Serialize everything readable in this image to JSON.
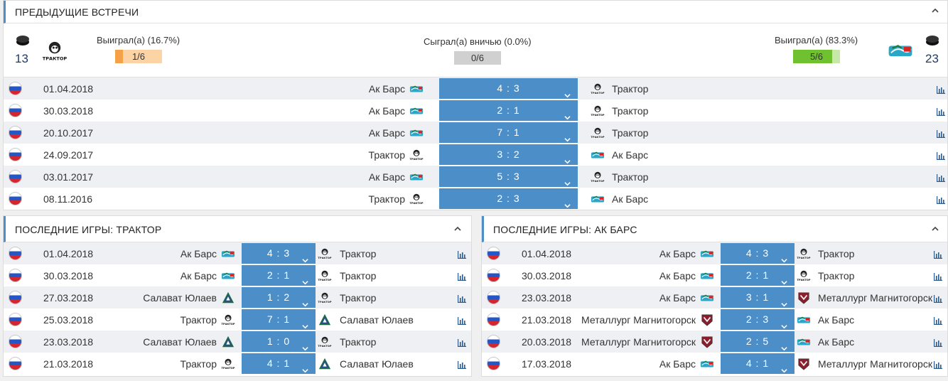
{
  "h2h": {
    "title": "ПРЕДЫДУЩИЕ ВСТРЕЧИ",
    "left_count": "13",
    "right_count": "23",
    "left_team_logo": "traktor-logo",
    "right_team_logo": "ak-bars-logo",
    "win_left": {
      "label": "Выиграл(а) (16.7%)",
      "value": "1/6",
      "fraction": 0.167,
      "color": "#f5a147"
    },
    "draw": {
      "label": "Сыграл(а) вничью (0.0%)",
      "value": "0/6",
      "fraction": 0.0,
      "color": "#c8c8c8"
    },
    "win_right": {
      "label": "Выиграл(а) (83.3%)",
      "value": "5/6",
      "fraction": 0.833,
      "color": "#6fc12f"
    },
    "matches": [
      {
        "date": "01.04.2018",
        "home": "Ак Барс",
        "home_logo": "ak-bars-logo",
        "score": "4 : 3",
        "away": "Трактор",
        "away_logo": "traktor-logo"
      },
      {
        "date": "30.03.2018",
        "home": "Ак Барс",
        "home_logo": "ak-bars-logo",
        "score": "2 : 1",
        "away": "Трактор",
        "away_logo": "traktor-logo"
      },
      {
        "date": "20.10.2017",
        "home": "Ак Барс",
        "home_logo": "ak-bars-logo",
        "score": "7 : 1",
        "away": "Трактор",
        "away_logo": "traktor-logo"
      },
      {
        "date": "24.09.2017",
        "home": "Трактор",
        "home_logo": "traktor-logo",
        "score": "3 : 2",
        "away": "Ак Барс",
        "away_logo": "ak-bars-logo"
      },
      {
        "date": "03.01.2017",
        "home": "Ак Барс",
        "home_logo": "ak-bars-logo",
        "score": "5 : 3",
        "away": "Трактор",
        "away_logo": "traktor-logo"
      },
      {
        "date": "08.11.2016",
        "home": "Трактор",
        "home_logo": "traktor-logo",
        "score": "2 : 3",
        "away": "Ак Барс",
        "away_logo": "ak-bars-logo"
      }
    ]
  },
  "last_traktor": {
    "title": "ПОСЛЕДНИЕ ИГРЫ: ТРАКТОР",
    "matches": [
      {
        "date": "01.04.2018",
        "home": "Ак Барс",
        "home_logo": "ak-bars-logo",
        "score": "4 : 3",
        "away": "Трактор",
        "away_logo": "traktor-logo"
      },
      {
        "date": "30.03.2018",
        "home": "Ак Барс",
        "home_logo": "ak-bars-logo",
        "score": "2 : 1",
        "away": "Трактор",
        "away_logo": "traktor-logo"
      },
      {
        "date": "27.03.2018",
        "home": "Салават Юлаев",
        "home_logo": "salavat-logo",
        "score": "1 : 2",
        "away": "Трактор",
        "away_logo": "traktor-logo"
      },
      {
        "date": "25.03.2018",
        "home": "Трактор",
        "home_logo": "traktor-logo",
        "score": "7 : 1",
        "away": "Салават Юлаев",
        "away_logo": "salavat-logo"
      },
      {
        "date": "23.03.2018",
        "home": "Салават Юлаев",
        "home_logo": "salavat-logo",
        "score": "1 : 0",
        "away": "Трактор",
        "away_logo": "traktor-logo"
      },
      {
        "date": "21.03.2018",
        "home": "Трактор",
        "home_logo": "traktor-logo",
        "score": "4 : 1",
        "away": "Салават Юлаев",
        "away_logo": "salavat-logo"
      }
    ]
  },
  "last_akbars": {
    "title": "ПОСЛЕДНИЕ ИГРЫ: АК БАРС",
    "matches": [
      {
        "date": "01.04.2018",
        "home": "Ак Барс",
        "home_logo": "ak-bars-logo",
        "score": "4 : 3",
        "away": "Трактор",
        "away_logo": "traktor-logo"
      },
      {
        "date": "30.03.2018",
        "home": "Ак Барс",
        "home_logo": "ak-bars-logo",
        "score": "2 : 1",
        "away": "Трактор",
        "away_logo": "traktor-logo"
      },
      {
        "date": "23.03.2018",
        "home": "Ак Барс",
        "home_logo": "ak-bars-logo",
        "score": "3 : 1",
        "away": "Металлург Магнитогорск",
        "away_logo": "metallurg-logo"
      },
      {
        "date": "21.03.2018",
        "home": "Металлург Магнитогорск",
        "home_logo": "metallurg-logo",
        "score": "2 : 3",
        "away": "Ак Барс",
        "away_logo": "ak-bars-logo"
      },
      {
        "date": "20.03.2018",
        "home": "Металлург Магнитогорск",
        "home_logo": "metallurg-logo",
        "score": "2 : 5",
        "away": "Ак Барс",
        "away_logo": "ak-bars-logo"
      },
      {
        "date": "17.03.2018",
        "home": "Ак Барс",
        "home_logo": "ak-bars-logo",
        "score": "4 : 1",
        "away": "Металлург Магнитогорск",
        "away_logo": "metallurg-logo"
      }
    ]
  },
  "colors": {
    "accent": "#4b8ec8",
    "row_alt": "#eef0f3"
  }
}
